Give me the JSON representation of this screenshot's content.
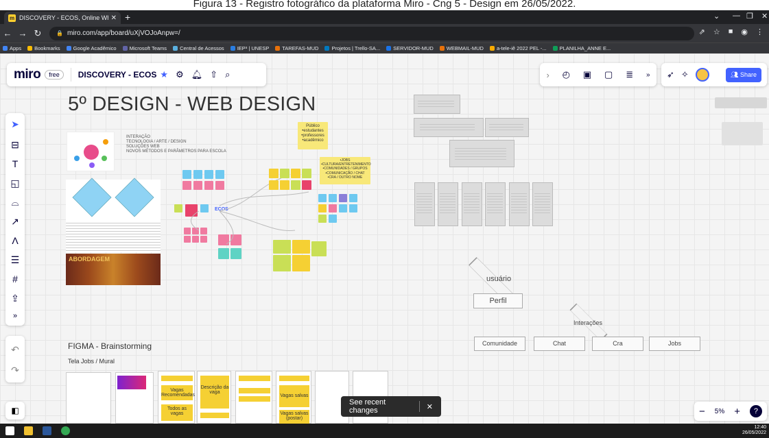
{
  "caption": "Figura 13 - Registro fotográfico da plataforma Miro - Cng 5 - Design em 26/05/2022.",
  "browser": {
    "tab_title": "DISCOVERY - ECOS, Online Whit",
    "url": "miro.com/app/board/uXjVOJoAnpw=/",
    "bookmarks": [
      "Apps",
      "Bookmarks",
      "Google Acadêmico",
      "Microsoft Teams",
      "Central de Acessos",
      "IEP³ | UNESP",
      "TAREFAS-MUD",
      "Projetos | Trello-SA...",
      "SERVIDOR-MUD",
      "WEBMAIL-MUD",
      "a-tele-iê 2022 PEL -...",
      "PLANILHA_ANNE E..."
    ]
  },
  "miro": {
    "logo": "miro",
    "plan": "free",
    "board_name": "DISCOVERY - ECOS",
    "share_label": "Share",
    "zoom": "5%",
    "toast": "See recent changes"
  },
  "board": {
    "title": "5º DESIGN - WEB DESIGN",
    "intro_lines": "INTERAÇÃO\nTECNOLOGIA / ARTE / DESIGN\nSOLUÇÕES WEB\nNOVOS MÉTODOS E PARÂMETROS PARA ESCOLA",
    "publico_note": "Público\n•estudantes\n•professores\n•acadêmico",
    "jobs_note": "•JOBS\n•CULTURA/ENTRETENIMENTO\n•COMUNIDADES / GRUPOS\n•COMUNICAÇÃO / CHAT\n•CRA / OUTRO NOME",
    "ecos_label": "ECOS",
    "abordagem": "ABORDAGEM",
    "user_diamond": "usuário",
    "perfil": "Perfil",
    "interacoes": "Interações",
    "interaction_boxes": [
      "Comunidade",
      "Chat",
      "Cra",
      "Jobs"
    ],
    "figma_title": "FIGMA - Brainstorming",
    "tela_label": "Tela Jobs / Mural",
    "yellow_notes": [
      "Vagas Recomendadas",
      "Todos as vagas",
      "Descrição da vaga",
      "Vagas salvas",
      "Vagas salvas (postar)"
    ]
  },
  "colors": {
    "miro_blue": "#4262ff",
    "sticky_yellow": "#f5d033",
    "sticky_blue": "#6ec9f0",
    "sticky_pink": "#f07aa0",
    "sticky_green": "#c9df56",
    "sticky_teal": "#5fd3c4"
  }
}
